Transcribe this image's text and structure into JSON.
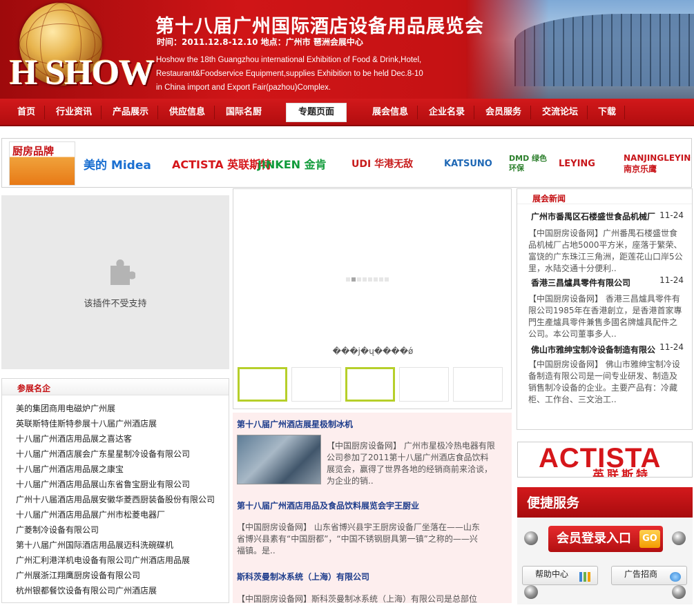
{
  "banner": {
    "logo_text": "H SHOW",
    "title": "第十八届广州国际酒店设备用品展览会",
    "date_line": "时间：2011.12.8-12.10    地点：广州市 琶洲会展中心",
    "english_lines": [
      "Hoshow the 18th Guangzhou international Exhibition of Food & Drink,Hotel,",
      "Restaurant&Foodservice Equipment,supplies Exhibition to be held Dec.8-10",
      "in China import and Export Fair(pazhou)Complex."
    ]
  },
  "nav": {
    "items": [
      "首页",
      "行业资讯",
      "产品展示",
      "供应信息",
      "国际名厨",
      "专题页面",
      "展会信息",
      "企业名录",
      "会员服务",
      "交流论坛",
      "下载"
    ],
    "active": "专题页面"
  },
  "brands": {
    "tag": "厨房品牌",
    "logos": [
      {
        "name": "美的 Midea",
        "color": "#1a6fd1"
      },
      {
        "name": "ACTISTA 英联斯特",
        "color": "#d5161a"
      },
      {
        "name": "JINKEN 金肯",
        "color": "#109b3a"
      },
      {
        "name": "UDI 华港无敌",
        "color": "#c71b1b"
      },
      {
        "name": "KATSUNO",
        "color": "#1f68b5"
      },
      {
        "name": "DMD 绿色环保",
        "color": "#2c7f2c"
      },
      {
        "name": "LEYING",
        "color": "#c8161b"
      },
      {
        "name": "NANJINGLEYING 南京乐鹰",
        "color": "#c8161b"
      }
    ]
  },
  "plugin": {
    "message": "该插件不受支持"
  },
  "exhibitors": {
    "title": "参展名企",
    "items": [
      "美的集团商用电磁炉广州展",
      "英联斯特佳斯特参展十八届广州酒店展",
      "十八届广州酒店用品展之喜达客",
      "十八届广州酒店展会广东星星制冷设备有限公司",
      "十八届广州酒店用品展之康宝",
      "十八届广州酒店用品展山东省鲁宝厨业有限公司",
      "广州十八届酒店用品展安徽华菱西厨装备股份有限公司",
      "十八届广州酒店用品展广州市松菱电器厂",
      "广菱制冷设备有限公司",
      "第十八届广州国际酒店用品展迈科洗碗碟机",
      "广州汇利港洋机电设备有限公司广州酒店用品展",
      "广州展浙江翔鹰厨房设备有限公司",
      "杭州银都餐饮设备有限公司广州酒店展"
    ]
  },
  "slider": {
    "caption": "���j�ų����ǿ",
    "dots": 8,
    "active_dot": 1
  },
  "mid_news": [
    {
      "title": "第十八届广州酒店展星极制冰机",
      "text": "【中国厨房设备网】 广州市星极冷热电器有限公司参加了2011第十八届广州酒店食品饮料展览会，赢得了世界各地的经销商前来洽谈，为企业的销.."
    },
    {
      "title": "第十八届广州酒店用品及食品饮料展览会宇王厨业",
      "text": "【中国厨房设备网】 山东省博兴县宇王厨房设备厂坐落在——山东省博兴县素有“中国厨都”，“中国不锈钢厨具第一镇”之称的——兴福镇。是.."
    },
    {
      "title": "斯科茨曼制冰系统（上海）有限公司",
      "text": "【中国厨房设备网】斯科茨曼制冰系统（上海）有限公司是总部位"
    }
  ],
  "right_news": {
    "title": "展会新闻",
    "items": [
      {
        "title": "广州市番禺区石楼盛世食品机械厂",
        "date": "11-24",
        "text": "【中国厨房设备网】广州番禺石楼盛世食品机械厂占地5000平方米，座落于繁荣、富饶的广东珠江三角洲，距莲花山口岸5公里，水陆交通十分便利.."
      },
      {
        "title": "香港三昌爐具零件有限公司",
        "date": "11-24",
        "text": "【中国厨房设备网】 香港三昌爐具零件有限公司1985年在香港創立，是香港首家專門生產爐具零件兼售多國名牌爐具配件之公司。本公司董事多人.."
      },
      {
        "title": "佛山市雅绅宝制冷设备制造有限公",
        "date": "11-24",
        "text": "【中国厨房设备网】 佛山市雅绅宝制冷设备制造有限公司是一间专业研发、制造及销售制冷设备的企业。主要产品有：冷藏柜、工作台、三文治工.."
      }
    ]
  },
  "ad": {
    "brand": "ACTISTA",
    "brand_cn": "英联斯特"
  },
  "quick": {
    "title": "便捷服务",
    "login": "会员登录入口",
    "go": "GO",
    "help": "帮助中心",
    "ads": "广告招商"
  }
}
